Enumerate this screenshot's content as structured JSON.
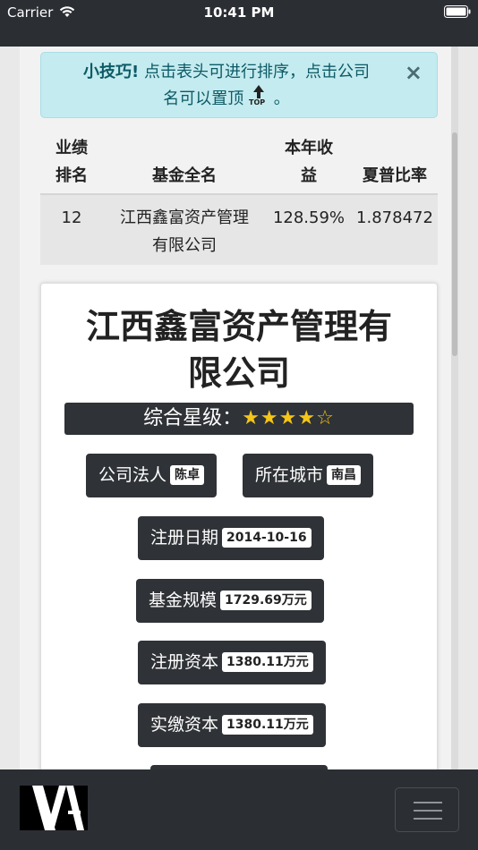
{
  "status_bar": {
    "carrier": "Carrier",
    "time": "10:41 PM"
  },
  "tip": {
    "strong": "小技巧!",
    "text_line1": " 点击表头可进行排序，点击公司",
    "text_line2": "名可以置顶",
    "badge": "TOP",
    "suffix": " 。",
    "close": "×"
  },
  "table": {
    "headers": {
      "rank_line1": "业绩",
      "rank_line2": "排名",
      "name": "基金全名",
      "return_line1": "本年收",
      "return_line2": "益",
      "sharpe": "夏普比率"
    },
    "row": {
      "rank": "12",
      "name_line1": "江西鑫富资产管理",
      "name_line2": "有限公司",
      "return": "128.59%",
      "sharpe": "1.878472"
    }
  },
  "card": {
    "title_line1": "江西鑫富资产管理有",
    "title_line2": "限公司",
    "rating_label": "综合星级：",
    "stars": "★★★★☆",
    "rating": 4,
    "rating_max": 5,
    "fields": [
      {
        "label": "公司法人",
        "value": "陈卓"
      },
      {
        "label": "所在城市",
        "value": "南昌"
      },
      {
        "label": "注册日期",
        "value": "2014-10-16"
      },
      {
        "label": "基金规模",
        "value": "1729.69万元"
      },
      {
        "label": "注册资本",
        "value": "1380.11万元"
      },
      {
        "label": "实缴资本",
        "value": "1380.11万元"
      }
    ]
  },
  "colors": {
    "dark": "#2f3236",
    "tip_bg": "#c4ebef",
    "star": "#f5c518"
  }
}
